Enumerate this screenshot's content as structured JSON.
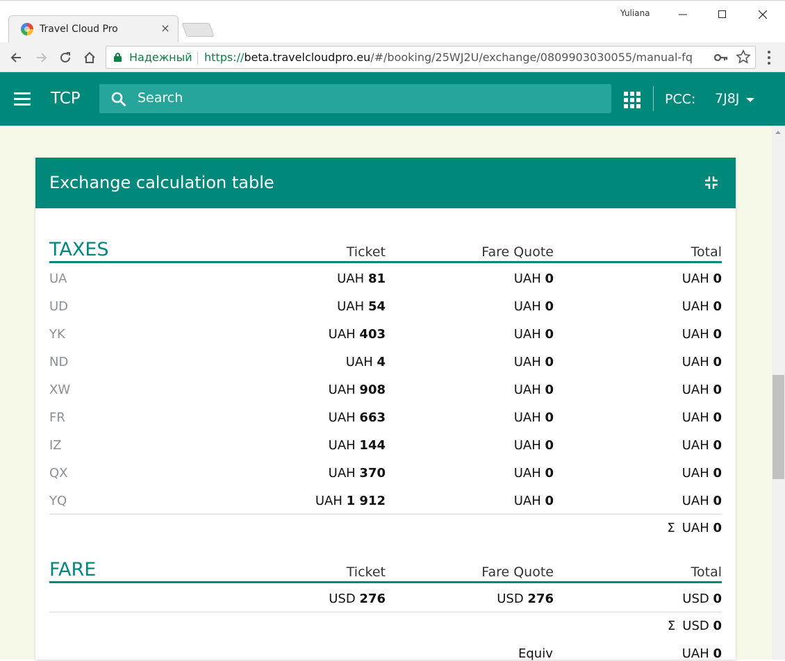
{
  "browser": {
    "tab_title": "Travel Cloud Pro",
    "tab_close": "×",
    "profile_name": "Yuliana",
    "secure_label": "Надежный",
    "url_scheme": "https://",
    "url_host": "beta.travelcloudpro.eu",
    "url_path": "/#/booking/25WJ2U/exchange/0809903030055/manual-fq"
  },
  "appbar": {
    "title": "TCP",
    "search_placeholder": "Search",
    "pcc_label": "PCC:",
    "pcc_value": "7J8J"
  },
  "card": {
    "title": "Exchange calculation table"
  },
  "taxes": {
    "title": "TAXES",
    "headers": {
      "ticket": "Ticket",
      "fare_quote": "Fare Quote",
      "total": "Total"
    },
    "rows": [
      {
        "code": "UA",
        "ticket_cur": "UAH",
        "ticket": "81",
        "fq_cur": "UAH",
        "fq": "0",
        "total_cur": "UAH",
        "total": "0"
      },
      {
        "code": "UD",
        "ticket_cur": "UAH",
        "ticket": "54",
        "fq_cur": "UAH",
        "fq": "0",
        "total_cur": "UAH",
        "total": "0"
      },
      {
        "code": "YK",
        "ticket_cur": "UAH",
        "ticket": "403",
        "fq_cur": "UAH",
        "fq": "0",
        "total_cur": "UAH",
        "total": "0"
      },
      {
        "code": "ND",
        "ticket_cur": "UAH",
        "ticket": "4",
        "fq_cur": "UAH",
        "fq": "0",
        "total_cur": "UAH",
        "total": "0"
      },
      {
        "code": "XW",
        "ticket_cur": "UAH",
        "ticket": "908",
        "fq_cur": "UAH",
        "fq": "0",
        "total_cur": "UAH",
        "total": "0"
      },
      {
        "code": "FR",
        "ticket_cur": "UAH",
        "ticket": "663",
        "fq_cur": "UAH",
        "fq": "0",
        "total_cur": "UAH",
        "total": "0"
      },
      {
        "code": "IZ",
        "ticket_cur": "UAH",
        "ticket": "144",
        "fq_cur": "UAH",
        "fq": "0",
        "total_cur": "UAH",
        "total": "0"
      },
      {
        "code": "QX",
        "ticket_cur": "UAH",
        "ticket": "370",
        "fq_cur": "UAH",
        "fq": "0",
        "total_cur": "UAH",
        "total": "0"
      },
      {
        "code": "YQ",
        "ticket_cur": "UAH",
        "ticket": "1 912",
        "fq_cur": "UAH",
        "fq": "0",
        "total_cur": "UAH",
        "total": "0"
      }
    ],
    "sum_symbol": "Σ",
    "sum_cur": "UAH",
    "sum_value": "0"
  },
  "fare": {
    "title": "FARE",
    "headers": {
      "ticket": "Ticket",
      "fare_quote": "Fare Quote",
      "total": "Total"
    },
    "row": {
      "ticket_cur": "USD",
      "ticket": "276",
      "fq_cur": "USD",
      "fq": "276",
      "total_cur": "USD",
      "total": "0"
    },
    "sum_symbol": "Σ",
    "sum_cur": "USD",
    "sum_value": "0",
    "equiv_label": "Equiv",
    "equiv_cur": "UAH",
    "equiv_value": "0"
  },
  "colors": {
    "primary": "#00897b",
    "search_bg": "#26a69a",
    "page_bg": "#f6f8e8",
    "secure_green": "#0b8043",
    "code_gray": "#8a8f93"
  }
}
